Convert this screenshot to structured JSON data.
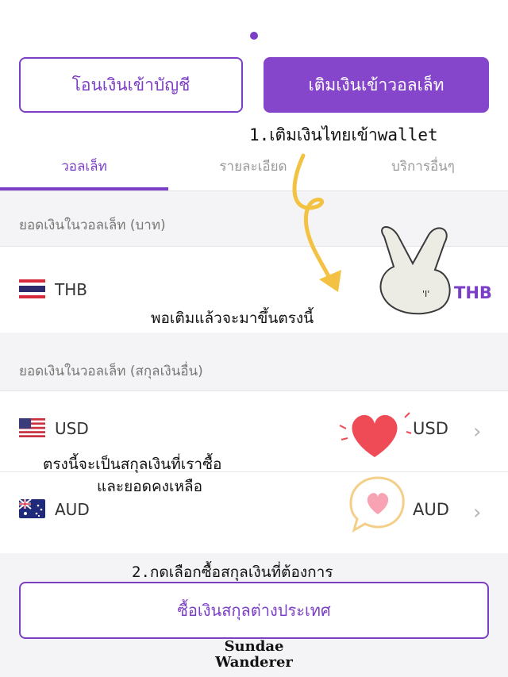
{
  "header": {
    "transfer_button": "โอนเงินเข้าบัญชี",
    "topup_button": "เติมเงินเข้าวอลเล็ท"
  },
  "tabs": [
    "วอลเล็ท",
    "รายละเอียด",
    "บริการอื่นๆ"
  ],
  "sections": {
    "thb_title": "ยอดเงินในวอลเล็ท (บาท)",
    "foreign_title": "ยอดเงินในวอลเล็ท (สกุลเงินอื่น)"
  },
  "wallets": {
    "thb": {
      "code": "THB",
      "right_code": "THB"
    },
    "usd": {
      "code": "USD",
      "right_code": "USD"
    },
    "aud": {
      "code": "AUD",
      "right_code": "AUD"
    }
  },
  "chevron": "›",
  "buy_button": "ซื้อเงินสกุลต่างประเทศ",
  "annotations": {
    "step1": "1.เติมเงินไทยเข้าwallet",
    "arrival_note": "พอเติมแล้วจะมาขึ้นตรงนี้",
    "currency_note_line1": "ตรงนี้จะเป็นสกุลเงินที่เราซื้อ",
    "currency_note_line2": "และยอดคงเหลือ",
    "step2": "2.กดเลือกซื้อสกุลเงินที่ต้องการ",
    "sticker_text": "'I'"
  },
  "watermark": {
    "line1": "Sundae",
    "line2": "Wanderer"
  },
  "colors": {
    "accent": "#7b3fc6",
    "arrow": "#f3c242",
    "heart": "#ef4b57",
    "heart_light": "#f7a3b4"
  }
}
